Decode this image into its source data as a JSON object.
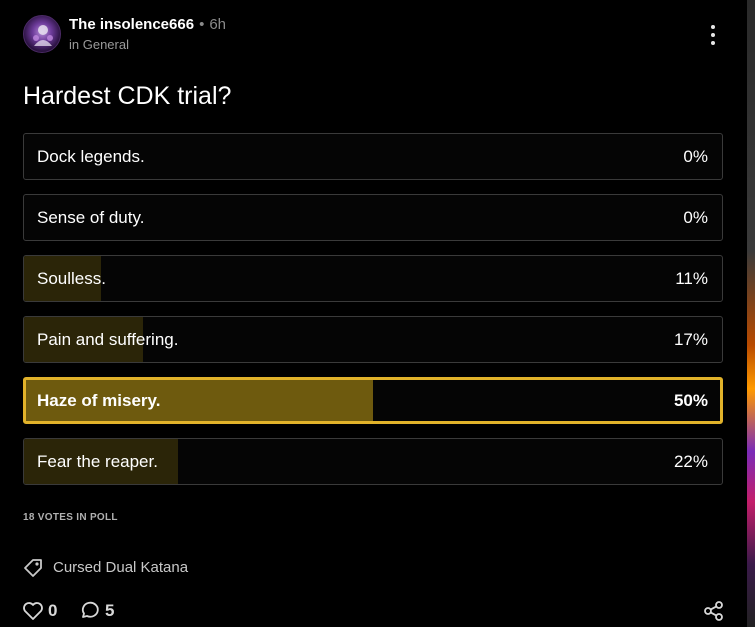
{
  "post": {
    "author": "The insolence666",
    "separator": "•",
    "time": "6h",
    "community": "in General",
    "title": "Hardest CDK trial?"
  },
  "poll": {
    "options": [
      {
        "label": "Dock legends.",
        "percent_text": "0%",
        "percent": 0,
        "selected": false
      },
      {
        "label": "Sense of duty.",
        "percent_text": "0%",
        "percent": 0,
        "selected": false
      },
      {
        "label": "Soulless.",
        "percent_text": "11%",
        "percent": 11,
        "selected": false
      },
      {
        "label": "Pain and suffering.",
        "percent_text": "17%",
        "percent": 17,
        "selected": false
      },
      {
        "label": "Haze of misery.",
        "percent_text": "50%",
        "percent": 50,
        "selected": true
      },
      {
        "label": "Fear the reaper.",
        "percent_text": "22%",
        "percent": 22,
        "selected": false
      }
    ],
    "votes_text": "18 VOTES IN POLL"
  },
  "tag": {
    "label": "Cursed Dual Katana",
    "icon": "tag-icon"
  },
  "actions": {
    "likes": "0",
    "comments": "5",
    "like_icon": "heart-icon",
    "comment_icon": "comment-icon",
    "share_icon": "share-icon"
  },
  "colors": {
    "background": "#000000",
    "accent": "#e1b22a",
    "fill": "#2b2508",
    "selected_fill": "#6e5a0e"
  }
}
